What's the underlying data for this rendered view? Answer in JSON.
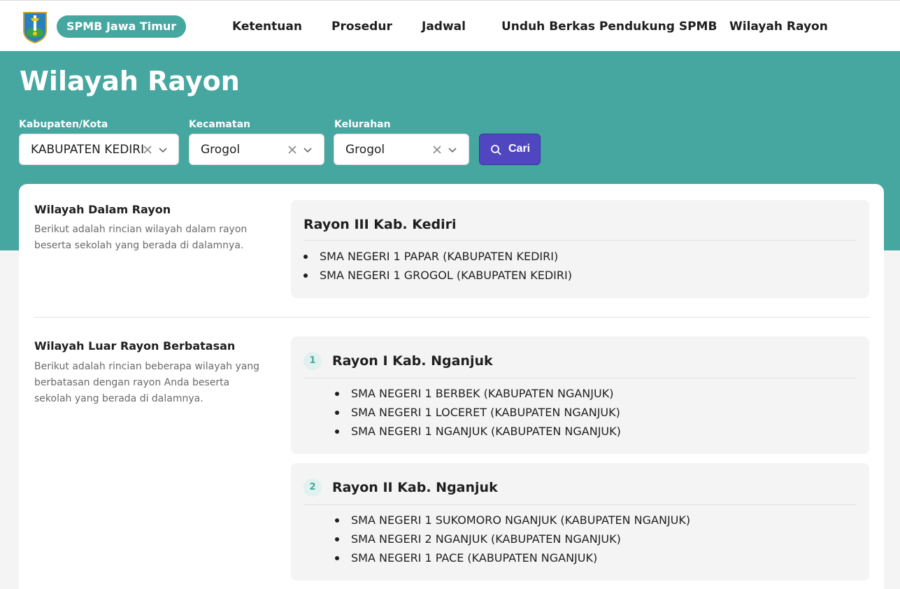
{
  "navbar": {
    "logo_icon": "east-java-emblem-icon",
    "brand": "SPMB Jawa Timur",
    "items": [
      "Ketentuan",
      "Prosedur",
      "Jadwal",
      "Unduh Berkas Pendukung SPMB",
      "Wilayah Rayon"
    ]
  },
  "hero": {
    "title": "Wilayah Rayon",
    "filters": [
      {
        "label": "Kabupaten/Kota",
        "value": "KABUPATEN KEDIRI"
      },
      {
        "label": "Kecamatan",
        "value": "Grogol"
      },
      {
        "label": "Kelurahan",
        "value": "Grogol"
      }
    ],
    "search_label": "Cari"
  },
  "inside": {
    "title": "Wilayah Dalam Rayon",
    "description": "Berikut adalah rincian wilayah dalam rayon beserta sekolah yang berada di dalamnya.",
    "rayon": {
      "name": "Rayon III Kab. Kediri",
      "schools": [
        "SMA NEGERI 1 PAPAR (KABUPATEN KEDIRI)",
        "SMA NEGERI 1 GROGOL (KABUPATEN KEDIRI)"
      ]
    }
  },
  "outside": {
    "title": "Wilayah Luar Rayon Berbatasan",
    "description": "Berikut adalah rincian beberapa wilayah yang berbatasan dengan rayon Anda beserta sekolah yang berada di dalamnya.",
    "rayons": [
      {
        "number": "1",
        "name": "Rayon I Kab. Nganjuk",
        "schools": [
          "SMA NEGERI 1 BERBEK (KABUPATEN NGANJUK)",
          "SMA NEGERI 1 LOCERET (KABUPATEN NGANJUK)",
          "SMA NEGERI 1 NGANJUK (KABUPATEN NGANJUK)"
        ]
      },
      {
        "number": "2",
        "name": "Rayon II Kab. Nganjuk",
        "schools": [
          "SMA NEGERI 1 SUKOMORO NGANJUK (KABUPATEN NGANJUK)",
          "SMA NEGERI 2 NGANJUK (KABUPATEN NGANJUK)",
          "SMA NEGERI 1 PACE (KABUPATEN NGANJUK)"
        ]
      }
    ]
  },
  "colors": {
    "teal": "#45a7a0",
    "button": "#5046c0",
    "panel": "#f4f4f4"
  }
}
